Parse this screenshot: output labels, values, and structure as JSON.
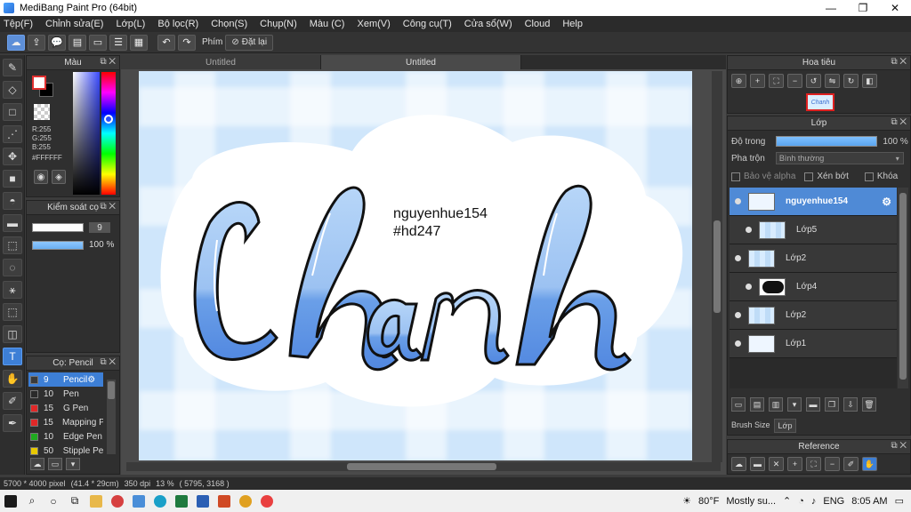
{
  "window": {
    "title": "MediBang Paint Pro (64bit)",
    "minimize": "—",
    "maximize": "❐",
    "close": "✕"
  },
  "menu": [
    "Tệp(F)",
    "Chỉnh sửa(E)",
    "Lớp(L)",
    "Bộ lọc(R)",
    "Chọn(S)",
    "Chụp(N)",
    "Màu (C)",
    "Xem(V)",
    "Công cụ(T)",
    "Cửa sổ(W)",
    "Cloud",
    "Help"
  ],
  "toolbar": {
    "shortcut_label": "Phím",
    "reset_label": "Đặt lại"
  },
  "color_panel": {
    "title": "Màu",
    "r": "R:255",
    "g": "G:255",
    "b": "B:255",
    "hex": "#FFFFFF"
  },
  "control_panel": {
    "title": "Kiểm soát cọ",
    "size_value": "9",
    "opacity_value": "100 %",
    "size_fill": 1.0,
    "opacity_fill": 1.0
  },
  "brush_panel": {
    "title": "Cọ: Pencil",
    "brushes": [
      {
        "size": "9",
        "name": "Pencil",
        "color": "#3a3a3a",
        "active": true
      },
      {
        "size": "10",
        "name": "Pen",
        "color": "#2a2a2a",
        "active": false
      },
      {
        "size": "15",
        "name": "G Pen",
        "color": "#e02828",
        "active": false
      },
      {
        "size": "15",
        "name": "Mapping P",
        "color": "#e02828",
        "active": false
      },
      {
        "size": "10",
        "name": "Edge Pen",
        "color": "#1faa1f",
        "active": false
      },
      {
        "size": "50",
        "name": "Stipple Pe",
        "color": "#e8c800",
        "active": false
      }
    ]
  },
  "tabs": [
    {
      "label": "Untitled",
      "active": false
    },
    {
      "label": "Untitled",
      "active": true
    }
  ],
  "canvas": {
    "lettering": "Chanh",
    "handle": "nguyenhue154",
    "hashtag": "#hd247"
  },
  "navigator": {
    "title": "Hoa tiêu",
    "thumb_text": "Chanh"
  },
  "layer_panel": {
    "title": "Lớp",
    "opacity_label": "Độ trong",
    "opacity_value": "100 %",
    "opacity_fill": 1.0,
    "blend_label": "Pha trộn",
    "blend_value": "Bình thường",
    "protect_alpha": "Bảo vệ alpha",
    "clipping": "Xén bớt",
    "lock": "Khóa",
    "layers": [
      {
        "name": "nguyenhue154",
        "active": true,
        "sub": false,
        "thumb": "logo"
      },
      {
        "name": "Lớp5",
        "active": false,
        "sub": true,
        "thumb": "grid"
      },
      {
        "name": "Lớp2",
        "active": false,
        "sub": false,
        "thumb": "grid"
      },
      {
        "name": "Lớp4",
        "active": false,
        "sub": true,
        "thumb": "dark"
      },
      {
        "name": "Lớp2",
        "active": false,
        "sub": false,
        "thumb": "grid"
      },
      {
        "name": "Lớp1",
        "active": false,
        "sub": false,
        "thumb": "white"
      }
    ],
    "tab_brush_size": "Brush Size",
    "tab_layer": "Lớp"
  },
  "reference": {
    "title": "Reference"
  },
  "status": {
    "size": "5700 * 4000 pixel",
    "cm": "(41.4 * 29cm)",
    "dpi": "350 dpi",
    "zoom": "13 %",
    "coords": "( 5795, 3168 )"
  },
  "taskbar": {
    "weather_temp": "80°F",
    "weather_text": "Mostly su...",
    "lang": "ENG",
    "time": "8:05 AM"
  },
  "colors": {
    "accent": "#3d7fd6",
    "lettering_top": "#a8cdf6",
    "lettering_bottom": "#5b93e6",
    "canvas_bg": "#cfe6fb"
  }
}
